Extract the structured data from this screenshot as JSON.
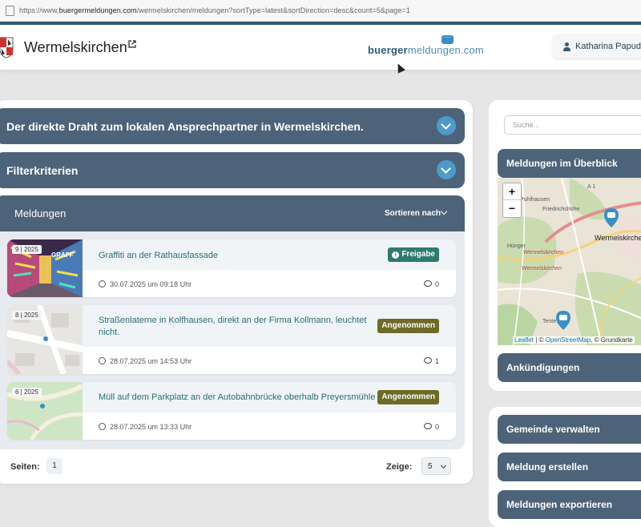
{
  "browser": {
    "url_prefix": "https://www.",
    "url_domain": "buergermeldungen.com",
    "url_rest": "/wermelskirchen/meldungen?sortType=latest&sortDirection=desc&count=5&page=1"
  },
  "header": {
    "town": "Wermelskirchen",
    "brand_a": "buerger",
    "brand_b": "meldungen",
    "brand_c": ".com",
    "user": "Katharina Papudi"
  },
  "sections": {
    "draht": "Der direkte Draht zum lokalen Ansprechpartner in Wermelskirchen.",
    "filter": "Filterkriterien"
  },
  "meldungen": {
    "title": "Meldungen",
    "sort_label": "Sortieren nach",
    "items": [
      {
        "date": "9 | 2025",
        "title": "Graffiti an der Rathausfassade",
        "status": "Freigabe",
        "meta": "30.07.2025 um 09:18 Uhr",
        "comments": "0"
      },
      {
        "date": "8 | 2025",
        "title": "Straßenlaterne in Kolfhausen, direkt an der Firma Kollmann, leuchtet nicht.",
        "status": "Angenommen",
        "meta": "28.07.2025 um 14:53 Uhr",
        "comments": "1"
      },
      {
        "date": "6 | 2025",
        "title": "Müll auf dem Parkplatz an der Autobahnbrücke oberhalb Preyersmühle",
        "status": "Angenommen",
        "meta": "28.07.2025 um 13:33 Uhr",
        "comments": "0"
      }
    ]
  },
  "pager": {
    "pages_label": "Seiten:",
    "page": "1",
    "show_label": "Zeige:",
    "count": "5"
  },
  "sidebar": {
    "search_placeholder": "Suche...",
    "overview": "Meldungen im Überblick",
    "announcements": "Ankündigungen",
    "manage": "Gemeinde verwalten",
    "create": "Meldung erstellen",
    "export": "Meldungen exportieren"
  },
  "map": {
    "zoom_in": "+",
    "zoom_out": "−",
    "labels": [
      "Pohlhausen",
      "Friedrichshöhe",
      "A 1",
      "Wermelskirchen",
      "Hünger",
      "Wermelskirchen",
      "Wermelskirchen",
      "Tente"
    ],
    "attr_leaflet": "Leaflet",
    "attr_mid": " | © ",
    "attr_osm": "OpenStreetMap",
    "attr_end": ", © Grundkarte"
  },
  "colors": {
    "header_bar": "#4d6379",
    "accent": "#4d9acb",
    "status_green": "#2f7a6b",
    "status_olive": "#6d6b26",
    "title_text": "#2a6f74"
  }
}
